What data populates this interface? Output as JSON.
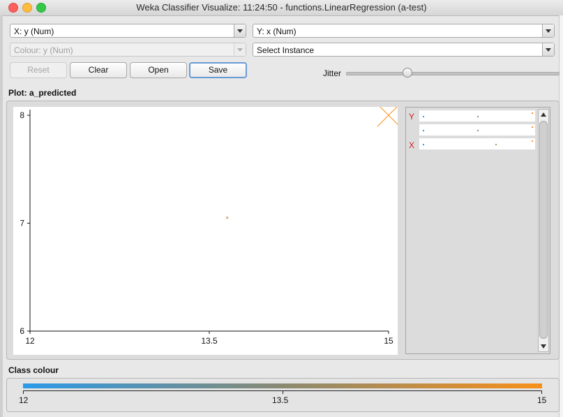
{
  "window": {
    "title": "Weka Classifier Visualize: 11:24:50 - functions.LinearRegression (a-test)"
  },
  "controls": {
    "x_axis": "X: y (Num)",
    "y_axis": "Y: x (Num)",
    "colour": "Colour: y (Num)",
    "select_instance": "Select Instance",
    "buttons": {
      "reset": "Reset",
      "clear": "Clear",
      "open": "Open",
      "save": "Save"
    },
    "jitter_label": "Jitter",
    "jitter_value_fraction": 0.3
  },
  "plot": {
    "title": "Plot: a_predicted"
  },
  "legend": {
    "letters": [
      "Y",
      "",
      "X"
    ]
  },
  "class_colour": {
    "label": "Class colour",
    "ticks": [
      "12",
      "13.5",
      "15"
    ],
    "start_color": "#2a9ae8",
    "end_color": "#f8901a"
  },
  "chart_data": {
    "type": "scatter",
    "title": "",
    "xlabel": "",
    "ylabel": "",
    "xlim": [
      12,
      15
    ],
    "ylim": [
      6,
      8
    ],
    "x_ticks": [
      "12",
      "13.5",
      "15"
    ],
    "y_ticks": [
      "8",
      "7",
      "6"
    ],
    "series": [
      {
        "points": [
          {
            "x": 13.65,
            "y": 7.05,
            "color": "#c9a060"
          },
          {
            "x": 15,
            "y": 8,
            "color": "#f8901a"
          }
        ]
      }
    ]
  }
}
